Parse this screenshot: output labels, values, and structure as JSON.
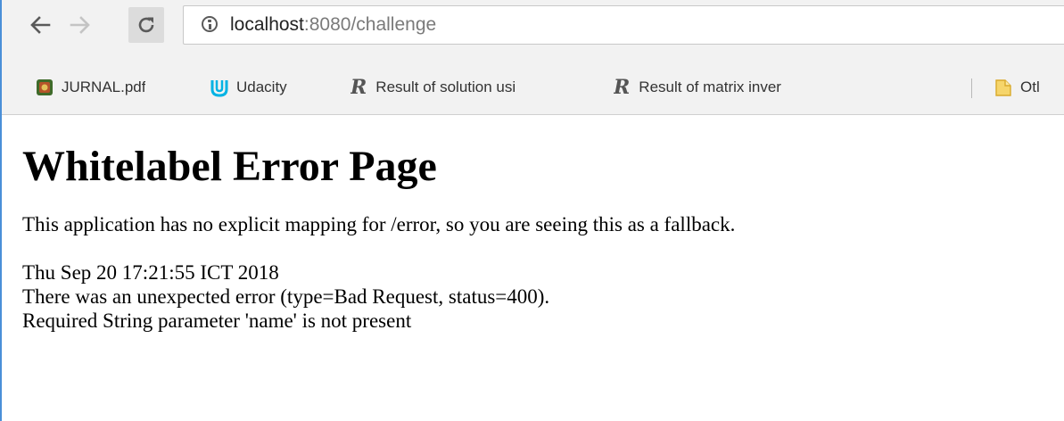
{
  "browser": {
    "url_host": "localhost",
    "url_rest": ":8080/challenge",
    "accent_color": "#4a8fd8"
  },
  "bookmarks": [
    {
      "label": "JURNAL.pdf",
      "icon": "pdf-document-icon"
    },
    {
      "label": "Udacity",
      "icon": "udacity-icon"
    },
    {
      "label": "Result of solution usi",
      "icon": "r-letter-icon"
    },
    {
      "label": "Result of matrix inver",
      "icon": "r-letter-icon"
    },
    {
      "label": "Otl",
      "icon": "folder-icon"
    }
  ],
  "page": {
    "title": "Whitelabel Error Page",
    "intro": "This application has no explicit mapping for /error, so you are seeing this as a fallback.",
    "timestamp": "Thu Sep 20 17:21:55 ICT 2018",
    "error_line": "There was an unexpected error (type=Bad Request, status=400).",
    "message": "Required String parameter 'name' is not present"
  }
}
